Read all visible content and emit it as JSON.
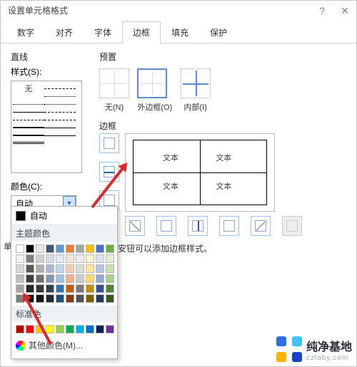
{
  "window": {
    "title": "设置单元格格式"
  },
  "tabs": {
    "number": "数字",
    "align": "对齐",
    "font": "字体",
    "border": "边框",
    "fill": "填充",
    "protect": "保护"
  },
  "line": {
    "section": "直线",
    "style_label": "样式(S):",
    "none": "无"
  },
  "preset": {
    "section": "预置",
    "none": "无(N)",
    "outer": "外边框(O)",
    "inner": "内部(I)"
  },
  "border_section": "边框",
  "preview_text": "文本",
  "color": {
    "label": "颜色(C):",
    "auto_selected": "自动"
  },
  "popup": {
    "auto": "自动",
    "theme": "主题颜色",
    "standard": "标准色",
    "more": "其他颜色(M)...",
    "theme_colors": [
      "#ffffff",
      "#000000",
      "#e7e6e6",
      "#44546a",
      "#5b9bd5",
      "#ed7d31",
      "#a5a5a5",
      "#ffc000",
      "#4472c4",
      "#70ad47",
      "#f2f2f2",
      "#7f7f7f",
      "#d0cece",
      "#d6dce4",
      "#deebf6",
      "#fbe5d5",
      "#ededed",
      "#fff2cc",
      "#dae3f3",
      "#e2efd9",
      "#d9d9d9",
      "#595959",
      "#aeabab",
      "#adb9ca",
      "#bdd7ee",
      "#f7cbac",
      "#dbdbdb",
      "#fee599",
      "#b4c6e7",
      "#c5e0b3",
      "#bfbfbf",
      "#3f3f3f",
      "#757070",
      "#8496b0",
      "#9cc3e5",
      "#f4b183",
      "#c9c9c9",
      "#ffd965",
      "#8eaadb",
      "#a8d08d",
      "#a5a5a5",
      "#262626",
      "#3a3838",
      "#323f4f",
      "#2e75b5",
      "#c55a11",
      "#7b7b7b",
      "#bf9000",
      "#2f5496",
      "#538135",
      "#7f7f7f",
      "#0c0c0c",
      "#161616",
      "#222a35",
      "#1e4e79",
      "#833c0b",
      "#525252",
      "#7f6000",
      "#1f3864",
      "#375623"
    ],
    "standard_colors": [
      "#c00000",
      "#ff0000",
      "#ffc000",
      "#ffff00",
      "#92d050",
      "#00b050",
      "#00b0f0",
      "#0070c0",
      "#002060",
      "#7030a0"
    ]
  },
  "hint_tail": "安钮可以添加边框样式。",
  "single_label": "单",
  "watermark": {
    "name": "纯净基地",
    "sub": "czlaby.com"
  }
}
